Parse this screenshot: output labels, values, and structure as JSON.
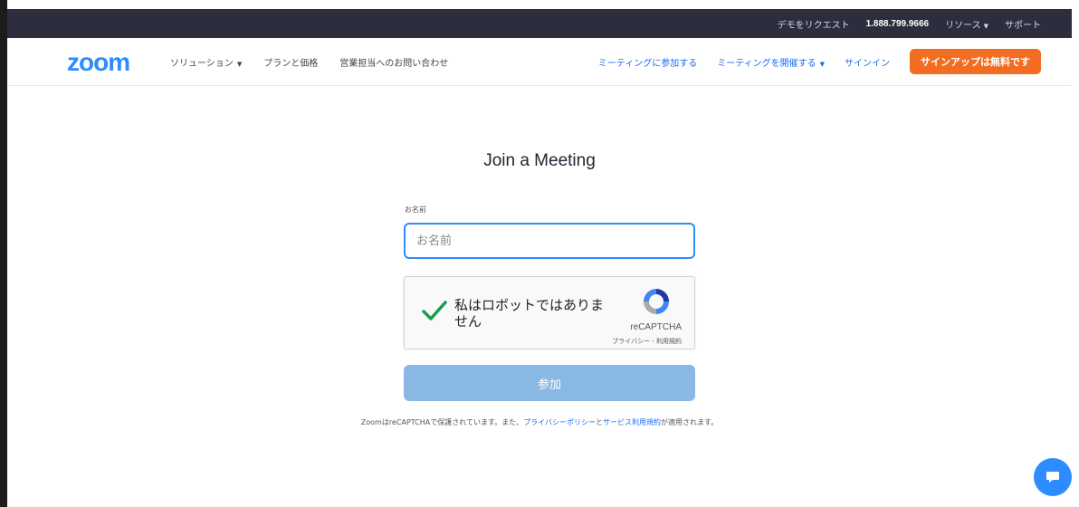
{
  "topbar": {
    "request_demo": "デモをリクエスト",
    "phone": "1.888.799.9666",
    "resources": "リソース",
    "support": "サポート"
  },
  "nav": {
    "logo": "zoom",
    "solutions": "ソリューション",
    "plans": "プランと価格",
    "contact_sales": "営業担当へのお問い合わせ",
    "join_meeting": "ミーティングに参加する",
    "host_meeting": "ミーティングを開催する",
    "sign_in": "サインイン",
    "sign_up": "サインアップは無料です"
  },
  "form": {
    "title": "Join a Meeting",
    "name_label": "お名前",
    "name_placeholder": "お名前",
    "captcha_text": "私はロボットではありません",
    "captcha_brand": "reCAPTCHA",
    "captcha_privacy": "プライバシー",
    "captcha_sep": " - ",
    "captcha_terms": "利用規約",
    "join_button": "参加"
  },
  "footnote": {
    "prefix": "ZoomはreCAPTCHAで保護されています。また、",
    "privacy_link": "プライバシーポリシー",
    "middle": "と",
    "terms_link": "サービス利用規約",
    "suffix": "が適用されます。"
  },
  "colors": {
    "brand_blue": "#2d8cff",
    "link_blue": "#1b6cf2",
    "signup_orange": "#f26d21",
    "topbar_bg": "#2d2e3d",
    "join_disabled": "#8ab8e4",
    "check_green": "#1a9d4e"
  },
  "icons": {
    "captcha_check": "checkmark-icon",
    "captcha_logo": "recaptcha-logo-icon",
    "chat": "chat-bubble-icon",
    "dropdown": "caret-down-icon"
  }
}
